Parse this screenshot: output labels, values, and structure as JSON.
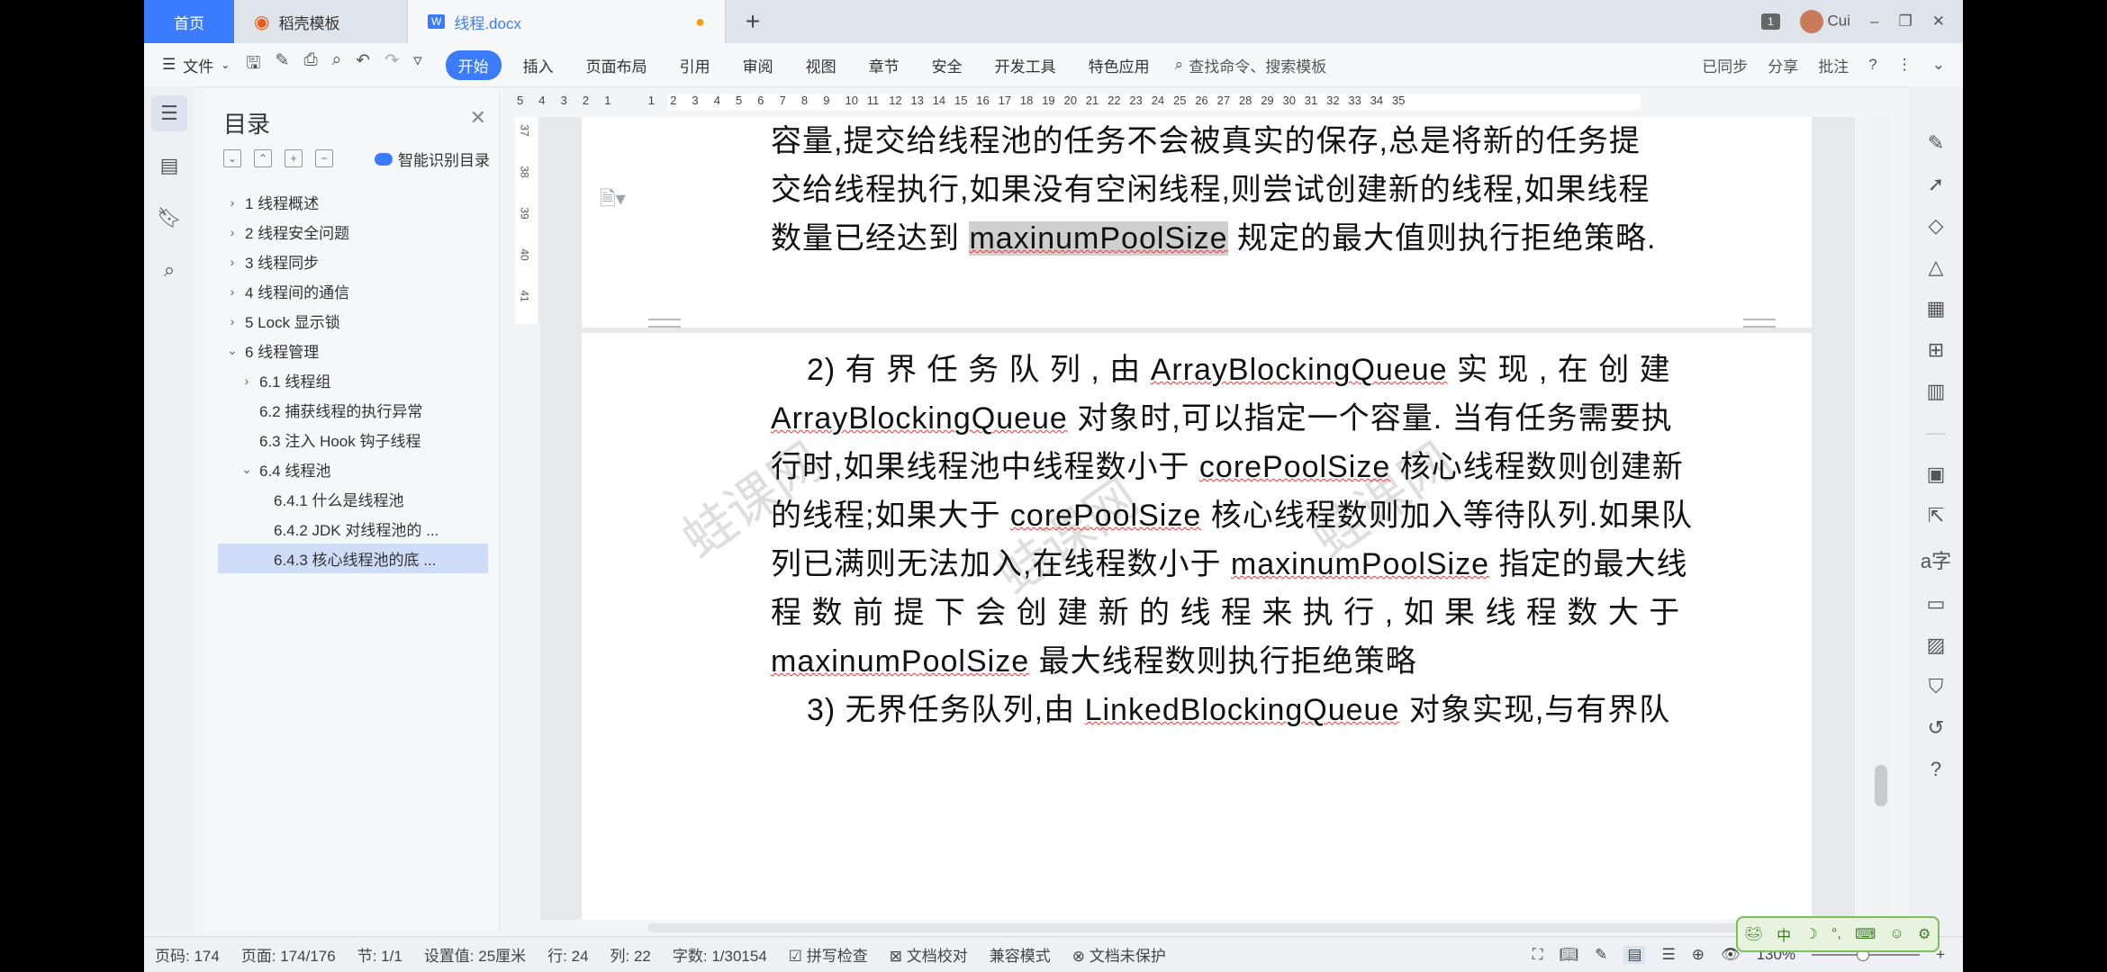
{
  "tabs": {
    "home": "首页",
    "template": "稻壳模板",
    "doc": "线程.docx",
    "unsaved_dot": "●",
    "plus": "+"
  },
  "titlebar": {
    "badge": "1",
    "user": "Cui",
    "min": "–",
    "restore": "❐",
    "close": "✕"
  },
  "ribbon": {
    "file": "文件",
    "tabs": [
      "开始",
      "插入",
      "页面布局",
      "引用",
      "审阅",
      "视图",
      "章节",
      "安全",
      "开发工具",
      "特色应用"
    ],
    "search": "查找命令、搜索模板",
    "right": [
      "已同步",
      "分享",
      "批注"
    ]
  },
  "toc": {
    "title": "目录",
    "smart": "智能识别目录",
    "items": [
      {
        "label": "1 线程概述",
        "caret": "›",
        "indent": 0
      },
      {
        "label": "2 线程安全问题",
        "caret": "›",
        "indent": 0
      },
      {
        "label": "3 线程同步",
        "caret": "›",
        "indent": 0
      },
      {
        "label": "4 线程间的通信",
        "caret": "›",
        "indent": 0
      },
      {
        "label": "5 Lock 显示锁",
        "caret": "›",
        "indent": 0
      },
      {
        "label": "6 线程管理",
        "caret": "⌄",
        "indent": 0
      },
      {
        "label": "6.1 线程组",
        "caret": "›",
        "indent": 1
      },
      {
        "label": "6.2 捕获线程的执行异常",
        "caret": "",
        "indent": 1
      },
      {
        "label": "6.3 注入 Hook 钩子线程",
        "caret": "",
        "indent": 1
      },
      {
        "label": "6.4 线程池",
        "caret": "⌄",
        "indent": 1
      },
      {
        "label": "6.4.1 什么是线程池",
        "caret": "",
        "indent": 2
      },
      {
        "label": "6.4.2 JDK 对线程池的 ...",
        "caret": "",
        "indent": 2
      },
      {
        "label": "6.4.3 核心线程池的底 ...",
        "caret": "",
        "indent": 2,
        "selected": true
      }
    ]
  },
  "ruler": {
    "numbers": [
      "5",
      "4",
      "3",
      "2",
      "1",
      "",
      "1",
      "2",
      "3",
      "4",
      "5",
      "6",
      "7",
      "8",
      "9",
      "10",
      "11",
      "12",
      "13",
      "14",
      "15",
      "16",
      "17",
      "18",
      "19",
      "20",
      "21",
      "22",
      "23",
      "24",
      "25",
      "26",
      "27",
      "28",
      "29",
      "30",
      "31",
      "32",
      "33",
      "34",
      "35"
    ],
    "vnumbers": [
      "37",
      "38",
      "39",
      "40",
      "41"
    ]
  },
  "document": {
    "page1_lines": [
      "容量,提交给线程池的任务不会被真实的保存,总是将新的任务提",
      "交给线程执行,如果没有空闲线程,则尝试创建新的线程,如果线程"
    ],
    "page1_line3_pre": "数量已经达到 ",
    "page1_line3_hl": "maxinumPoolSize",
    "page1_line3_post": " 规定的最大值则执行拒绝策略.",
    "page2": {
      "l1_pre": "2)  有 界 任 务 队 列 , 由 ",
      "l1_code": "ArrayBlockingQueue",
      "l1_post": "  实 现 , 在 创 建",
      "l2_code": "ArrayBlockingQueue",
      "l2_post": " 对象时,可以指定一个容量. 当有任务需要执",
      "l3_pre": "行时,如果线程池中线程数小于 ",
      "l3_code": "corePoolSize",
      "l3_post": " 核心线程数则创建新",
      "l4_pre": "的线程;如果大于 ",
      "l4_code": "corePoolSize",
      "l4_post": " 核心线程数则加入等待队列.如果队",
      "l5_pre": "列已满则无法加入,在线程数小于 ",
      "l5_code": "maxinumPoolSize",
      "l5_post": " 指定的最大线",
      "l6": "程 数 前 提 下 会 创 建 新 的 线 程 来 执 行 , 如 果 线 程 数 大 于",
      "l7_code": "maxinumPoolSize",
      "l7_post": " 最大线程数则执行拒绝策略",
      "l8_pre": "3)  无界任务队列,由 ",
      "l8_code": "LinkedBlockingQueue",
      "l8_post": " 对象实现,与有界队"
    },
    "watermark": "蛙课网"
  },
  "status": {
    "page_num": "页码: 174",
    "pages": "页面: 174/176",
    "section": "节: 1/1",
    "setting": "设置值: 25厘米",
    "row": "行: 24",
    "col": "列: 22",
    "words": "字数: 1/30154",
    "spell": "拼写检查",
    "proof": "文档校对",
    "compat": "兼容模式",
    "protect": "文档未保护",
    "zoom": "130%"
  },
  "ime": {
    "label": "中"
  },
  "colors": {
    "accent": "#3b7cff",
    "ime_green": "#7bbf56"
  }
}
